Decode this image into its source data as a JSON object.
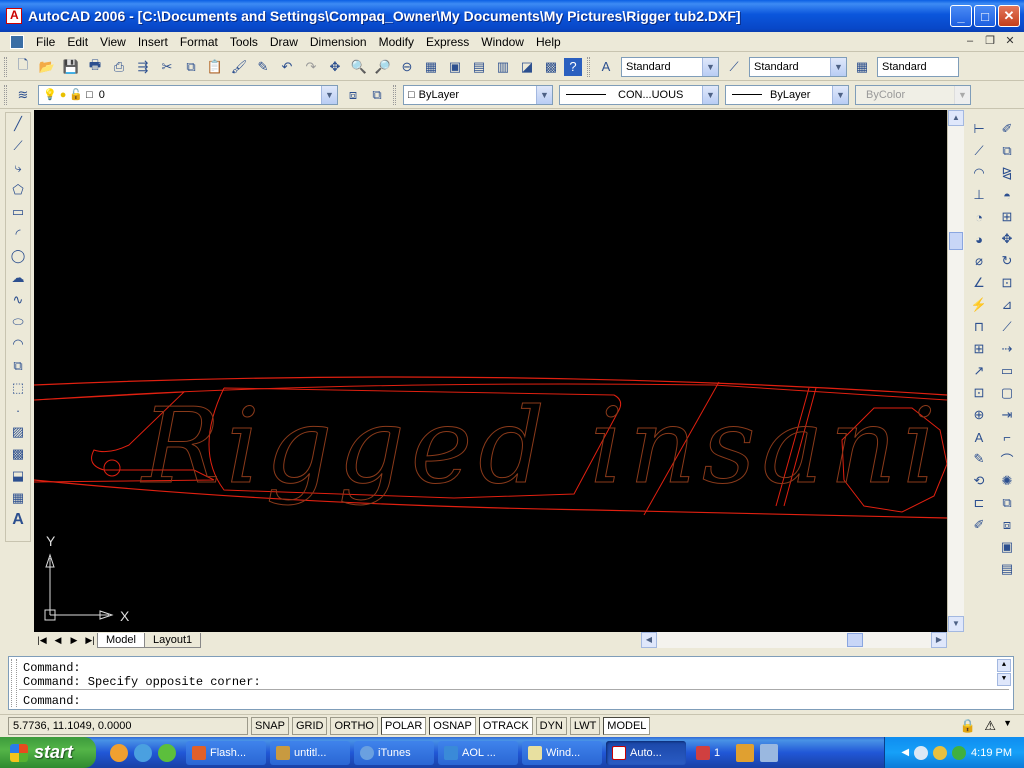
{
  "window": {
    "title": "AutoCAD 2006 - [C:\\Documents and Settings\\Compaq_Owner\\My Documents\\My Pictures\\Rigger tub2.DXF]",
    "buttons": [
      "_",
      "□",
      "✕"
    ]
  },
  "menu": {
    "items": [
      "File",
      "Edit",
      "View",
      "Insert",
      "Format",
      "Tools",
      "Draw",
      "Dimension",
      "Modify",
      "Express",
      "Window",
      "Help"
    ]
  },
  "styles_toolbar": {
    "text_style": "Standard",
    "dim_style": "Standard",
    "table_style": "Standard"
  },
  "layers_toolbar": {
    "layer": "0",
    "color": "ByLayer",
    "linetype": "CON...UOUS",
    "lineweight": "ByLayer",
    "plotstyle": "ByColor"
  },
  "drawing": {
    "text": "Rigged insanity",
    "ucs_x": "X",
    "ucs_y": "Y",
    "colors": {
      "background": "#000000",
      "outline": "#e02010",
      "text": "#8a3a1a"
    }
  },
  "layout_tabs": {
    "tabs": [
      "Model",
      "Layout1"
    ],
    "active": "Model"
  },
  "command": {
    "lines": [
      "Command:",
      "Command: Specify opposite corner:"
    ],
    "prompt": "Command:"
  },
  "status": {
    "coords": "5.7736, 11.1049, 0.0000",
    "toggles": [
      "SNAP",
      "GRID",
      "ORTHO",
      "POLAR",
      "OSNAP",
      "OTRACK",
      "DYN",
      "LWT",
      "MODEL"
    ]
  },
  "taskbar": {
    "start": "start",
    "tasks": [
      "Flash...",
      "untitl...",
      "iTunes",
      "AOL ...",
      "Wind...",
      "Auto..."
    ],
    "active_task": "Auto...",
    "group_count": "1",
    "time": "4:19 PM"
  }
}
